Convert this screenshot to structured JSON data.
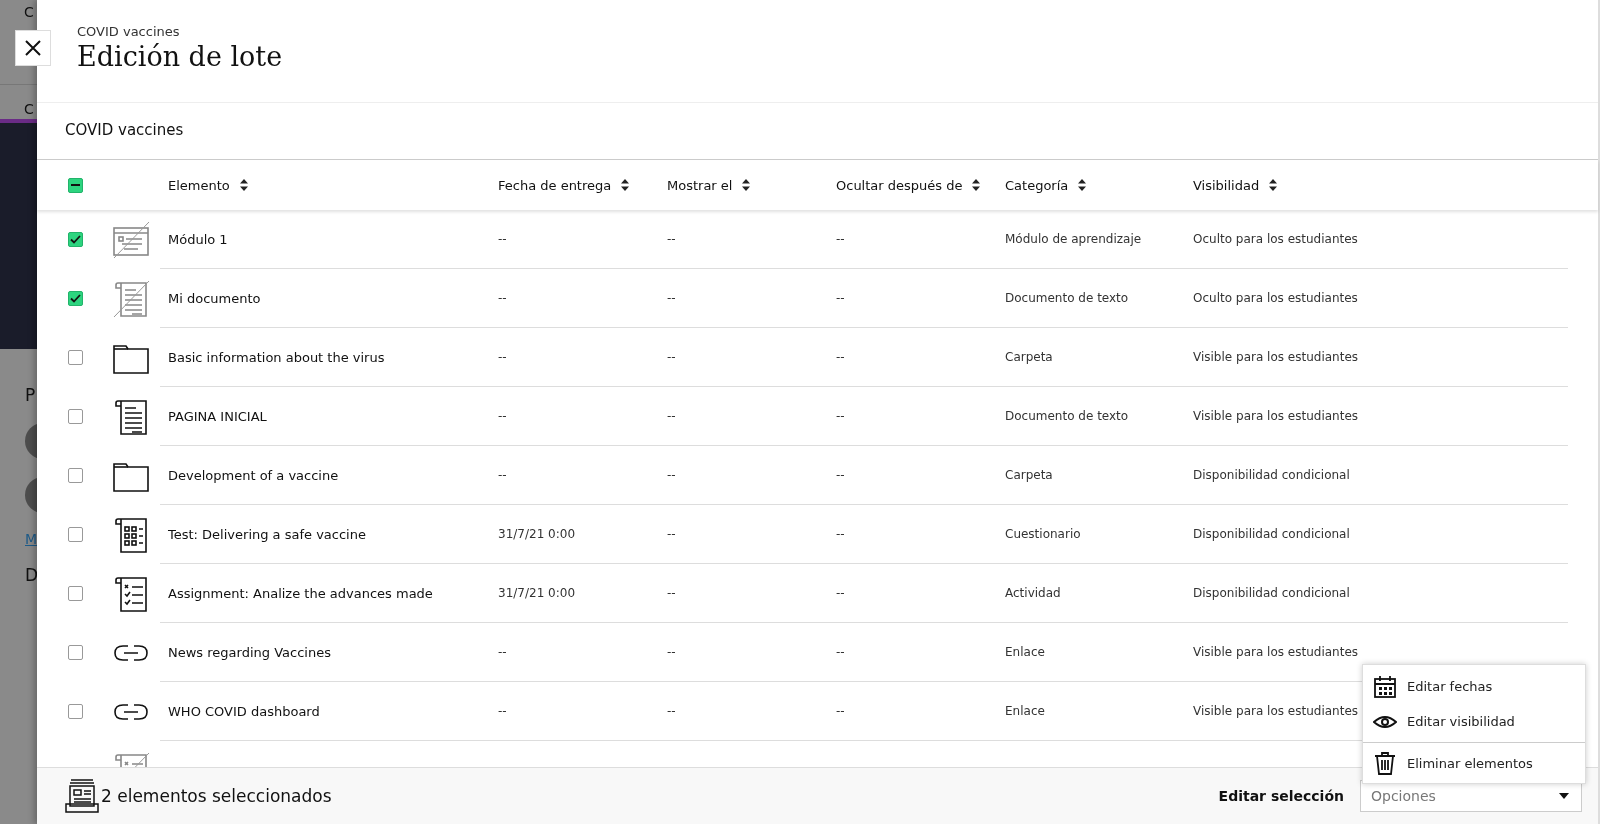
{
  "background": {
    "header_text": "C",
    "tab_text": "C",
    "section_letter": "P",
    "link_letter": "M",
    "section_letter_2": "D"
  },
  "header": {
    "breadcrumb": "COVID vaccines",
    "title": "Edición de lote"
  },
  "section": {
    "title": "COVID vaccines"
  },
  "table": {
    "select_all": {
      "mixed": true
    },
    "columns": [
      "Elemento",
      "Fecha de entrega",
      "Mostrar el",
      "Ocultar después de",
      "Categoría",
      "Visibilidad"
    ],
    "rows": [
      {
        "kind": "module",
        "hidden": true,
        "selected": true,
        "title": "Módulo 1",
        "due": "--",
        "show": "--",
        "hide_after": "--",
        "category": "Módulo de aprendizaje",
        "visibility": "Oculto para los estudiantes"
      },
      {
        "kind": "document",
        "hidden": true,
        "selected": true,
        "title": "Mi documento",
        "due": "--",
        "show": "--",
        "hide_after": "--",
        "category": "Documento de texto",
        "visibility": "Oculto para los estudiantes"
      },
      {
        "kind": "folder",
        "hidden": false,
        "selected": false,
        "title": "Basic information about the virus",
        "due": "--",
        "show": "--",
        "hide_after": "--",
        "category": "Carpeta",
        "visibility": "Visible para los estudiantes"
      },
      {
        "kind": "document",
        "hidden": false,
        "selected": false,
        "title": "PAGINA INICIAL",
        "due": "--",
        "show": "--",
        "hide_after": "--",
        "category": "Documento de texto",
        "visibility": "Visible para los estudiantes"
      },
      {
        "kind": "folder",
        "hidden": false,
        "selected": false,
        "title": "Development of a vaccine",
        "due": "--",
        "show": "--",
        "hide_after": "--",
        "category": "Carpeta",
        "visibility": "Disponibilidad condicional"
      },
      {
        "kind": "test",
        "hidden": false,
        "selected": false,
        "title": "Test: Delivering a safe vaccine",
        "due": "31/7/21 0:00",
        "show": "--",
        "hide_after": "--",
        "category": "Cuestionario",
        "visibility": "Disponibilidad condicional"
      },
      {
        "kind": "assignment",
        "hidden": false,
        "selected": false,
        "title": "Assignment: Analize the advances made",
        "due": "31/7/21 0:00",
        "show": "--",
        "hide_after": "--",
        "category": "Actividad",
        "visibility": "Disponibilidad condicional"
      },
      {
        "kind": "link",
        "hidden": false,
        "selected": false,
        "title": "News regarding Vaccines",
        "due": "--",
        "show": "--",
        "hide_after": "--",
        "category": "Enlace",
        "visibility": "Visible para los estudiantes"
      },
      {
        "kind": "link",
        "hidden": false,
        "selected": false,
        "title": "WHO COVID dashboard",
        "due": "--",
        "show": "--",
        "hide_after": "--",
        "category": "Enlace",
        "visibility": "Visible para los estudiantes"
      },
      {
        "kind": "assignment",
        "hidden": true
      }
    ]
  },
  "footer": {
    "selection_count": "2 elementos seleccionados",
    "edit_label": "Editar selección",
    "select_placeholder": "Opciones"
  },
  "menu": [
    {
      "kind": "calendar",
      "label": "Editar fechas"
    },
    {
      "kind": "eye",
      "label": "Editar visibilidad"
    },
    {
      "kind": "trash",
      "label": "Eliminar elementos"
    }
  ]
}
